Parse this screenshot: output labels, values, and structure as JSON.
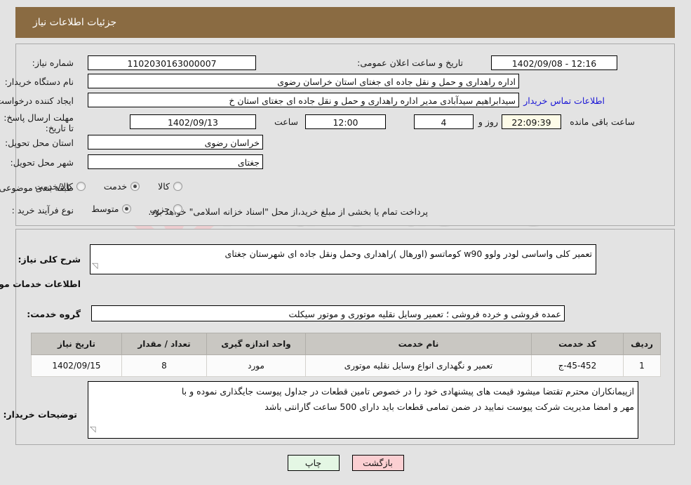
{
  "header": {
    "title": "جزئیات اطلاعات نیاز",
    "bar_color": "#8a6b42"
  },
  "watermark": {
    "text": "AriaTender.net"
  },
  "form": {
    "need_number_label": "شماره نیاز:",
    "need_number_value": "1102030163000007",
    "announce_label": "تاریخ و ساعت اعلان عمومی:",
    "announce_value": "1402/09/08 - 12:16",
    "buyer_org_label": "نام دستگاه خریدار:",
    "buyer_org_value": "اداره راهداری و حمل و نقل جاده ای جغتای استان خراسان رضوی",
    "creator_label": "ایجاد کننده درخواست:",
    "creator_value": "سیدابراهیم سیدآبادی مدیر اداره راهداری و حمل و نقل جاده ای جغتای استان خ",
    "contact_link": "اطلاعات تماس خریدار",
    "deadline_label": "مهلت ارسال پاسخ: تا تاریخ:",
    "deadline_date": "1402/09/13",
    "hour_label": "ساعت",
    "hour_value": "12:00",
    "days_value": "4",
    "days_label": "روز و",
    "timer_value": "22:09:39",
    "timer_label": "ساعت باقی مانده",
    "province_label": "استان محل تحویل:",
    "province_value": "خراسان رضوی",
    "city_label": "شهر محل تحویل:",
    "city_value": "جغتای",
    "category_label": "طبقه بندی موضوعی:",
    "category_options": [
      {
        "label": "کالا",
        "checked": false
      },
      {
        "label": "خدمت",
        "checked": true
      },
      {
        "label": "کالا/خدمت",
        "checked": false
      }
    ],
    "process_label": "نوع فرآیند خرید :",
    "process_options": [
      {
        "label": "جزیی",
        "checked": false
      },
      {
        "label": "متوسط",
        "checked": true
      }
    ],
    "payment_note": "پرداخت تمام یا بخشی از مبلغ خرید،از محل \"اسناد خزانه اسلامی\" خواهد بود."
  },
  "body": {
    "need_desc_label": "شرح کلی نیاز:",
    "need_desc_value": "تعمیر کلی واساسی لودر ولوو w90 کوماتسو (اورهال )راهداری وحمل ونقل جاده ای شهرستان جغتای",
    "services_heading": "اطلاعات خدمات مورد نیاز",
    "service_group_label": "گروه خدمت:",
    "service_group_value": "عمده فروشی و خرده فروشی ؛ تعمیر وسایل نقلیه موتوری و موتور سیکلت"
  },
  "table": {
    "columns": [
      "ردیف",
      "کد خدمت",
      "نام خدمت",
      "واحد اندازه گیری",
      "تعداد / مقدار",
      "تاریخ نیاز"
    ],
    "rows": [
      {
        "row": "1",
        "code": "ج-45-452",
        "name": "تعمیر و نگهداری انواع وسایل نقلیه موتوری",
        "unit": "مورد",
        "qty": "8",
        "date": "1402/09/15"
      }
    ]
  },
  "notes": {
    "label": "توضیحات خریدار:",
    "line1": "ازپیمانکاران محترم تقتضا میشود قیمت های پیشنهادی خود را در خصوص تامین قطعات در جداول پیوست جایگذاری نموده و با",
    "line2": "مهر و امضا مدیریت شرکت پیوست نمایید در ضمن تمامی قطعات باید دارای 500 ساعت گارانتی باشد"
  },
  "buttons": {
    "print": "چاپ",
    "back": "بازگشت"
  }
}
